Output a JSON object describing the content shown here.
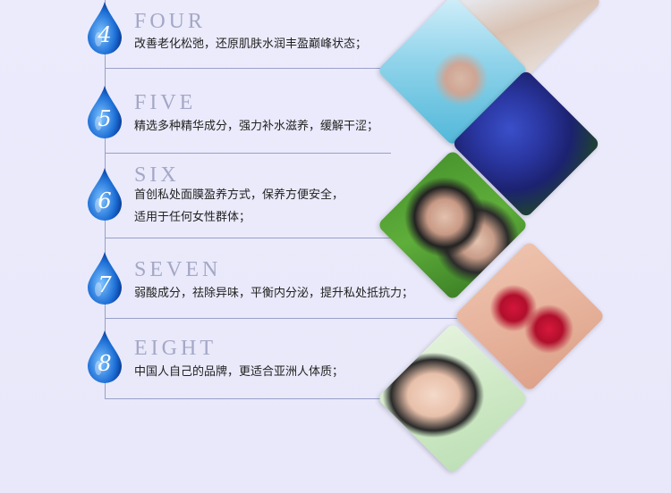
{
  "steps": [
    {
      "number": "4",
      "title": "FOUR",
      "lines": [
        "改善老化松弛，还原肌肤水润丰盈巅峰状态；"
      ]
    },
    {
      "number": "5",
      "title": "FIVE",
      "lines": [
        "精选多种精华成分，强力补水滋养，缓解干涩；"
      ]
    },
    {
      "number": "6",
      "title": "SIX",
      "lines": [
        "首创私处面膜盈养方式，保养方便安全，",
        "适用于任何女性群体；"
      ]
    },
    {
      "number": "7",
      "title": "SEVEN",
      "lines": [
        "弱酸成分，祛除异味，平衡内分泌，提升私处抵抗力；"
      ]
    },
    {
      "number": "8",
      "title": "EIGHT",
      "lines": [
        "中国人自己的品牌，更适合亚洲人体质；"
      ]
    }
  ],
  "photos": [
    {
      "icon": "doctor-photo-icon"
    },
    {
      "icon": "underwater-woman-photo-icon"
    },
    {
      "icon": "blue-flowers-photo-icon"
    },
    {
      "icon": "women-on-grass-photo-icon"
    },
    {
      "icon": "rose-petals-photo-icon"
    },
    {
      "icon": "smiling-woman-product-photo-icon"
    }
  ],
  "colors": {
    "accent_blue": "#1e6fd0",
    "title_gray": "#a4a7c6",
    "line": "#9aa0c8",
    "background": "#e9e9fb"
  }
}
